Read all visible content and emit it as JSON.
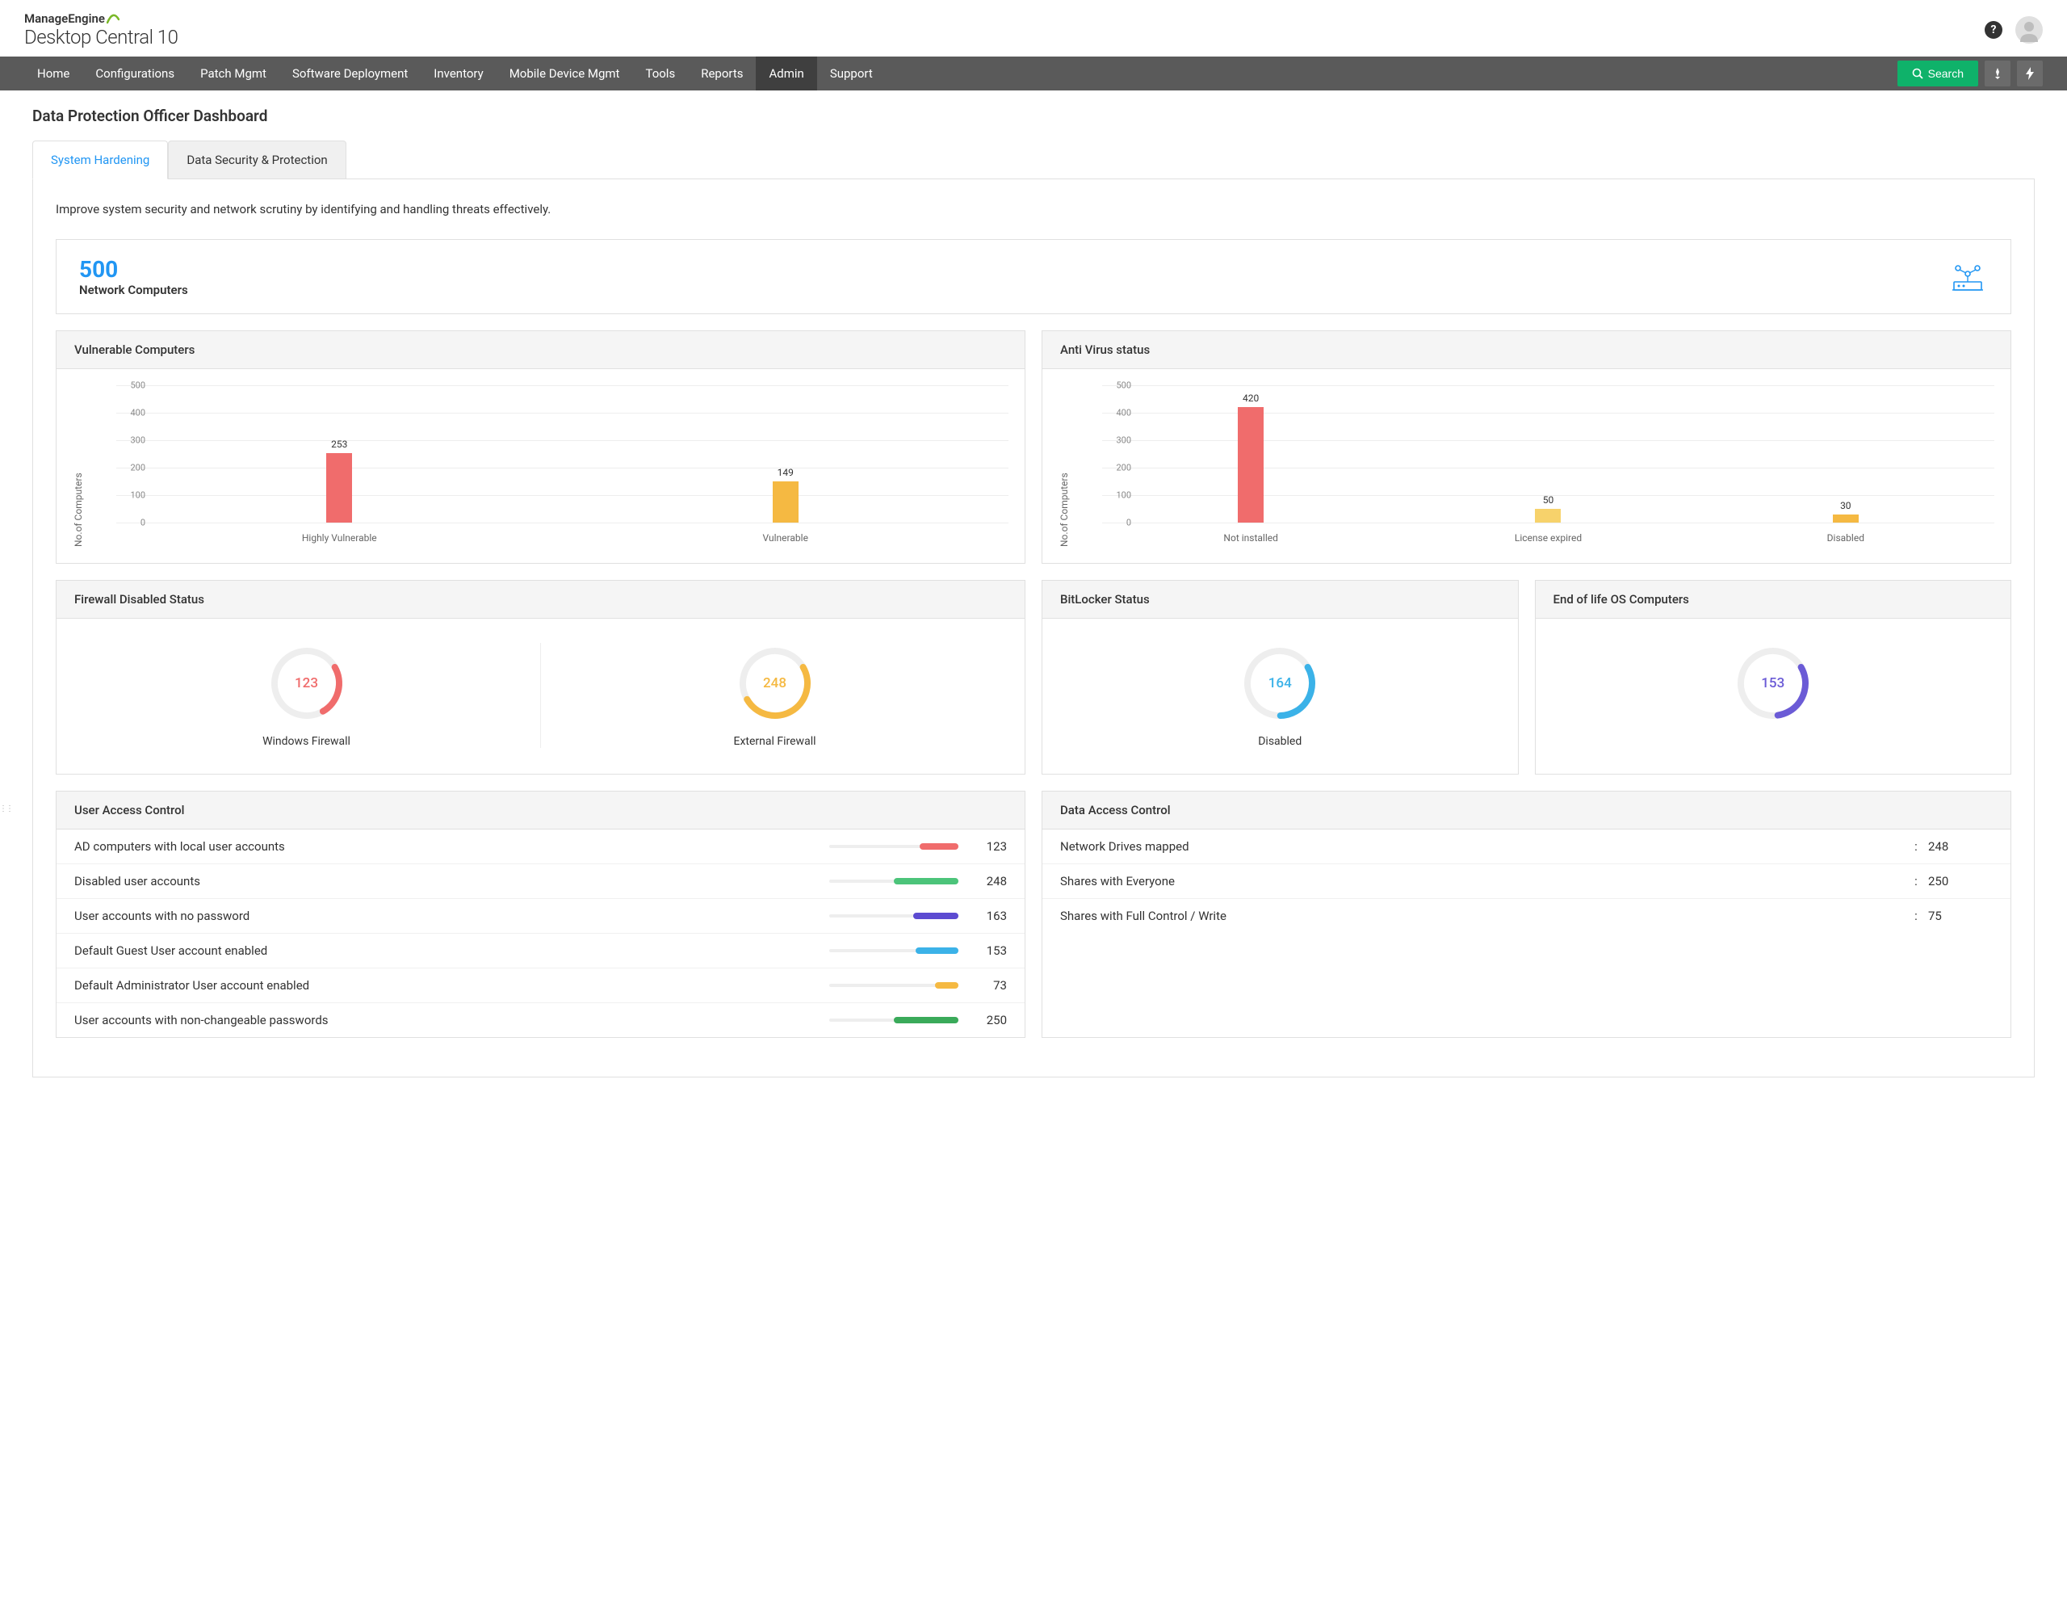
{
  "brand": {
    "top": "ManageEngine",
    "bottom": "Desktop Central 10"
  },
  "nav": {
    "items": [
      "Home",
      "Configurations",
      "Patch Mgmt",
      "Software Deployment",
      "Inventory",
      "Mobile Device Mgmt",
      "Tools",
      "Reports",
      "Admin",
      "Support"
    ],
    "active_index": 8,
    "search_label": "Search"
  },
  "page_title": "Data Protection Officer Dashboard",
  "tabs": {
    "items": [
      "System Hardening",
      "Data Security & Protection"
    ],
    "active_index": 0
  },
  "intro": "Improve system security and network scrutiny by identifying and handling threats effectively.",
  "summary": {
    "value": "500",
    "label": "Network Computers"
  },
  "chart_data": [
    {
      "id": "vulnerable",
      "type": "bar",
      "title": "Vulnerable Computers",
      "ylabel": "No.of Computers",
      "ylim": [
        0,
        500
      ],
      "yticks": [
        0,
        100,
        200,
        300,
        400,
        500
      ],
      "categories": [
        "Highly Vulnerable",
        "Vulnerable"
      ],
      "values": [
        253,
        149
      ],
      "colors": [
        "#f06c6c",
        "#f5b942"
      ]
    },
    {
      "id": "antivirus",
      "type": "bar",
      "title": "Anti Virus status",
      "ylabel": "No.of Computers",
      "ylim": [
        0,
        500
      ],
      "yticks": [
        0,
        100,
        200,
        300,
        400,
        500
      ],
      "categories": [
        "Not installed",
        "License expired",
        "Disabled"
      ],
      "values": [
        420,
        50,
        30
      ],
      "colors": [
        "#f06c6c",
        "#f7d26b",
        "#f5b942"
      ]
    },
    {
      "id": "firewall",
      "type": "donut",
      "title": "Firewall Disabled Status",
      "series": [
        {
          "name": "Windows Firewall",
          "value": 123,
          "color": "#f06c6c",
          "frac": 0.25
        },
        {
          "name": "External Firewall",
          "value": 248,
          "color": "#f5b942",
          "frac": 0.5
        }
      ]
    },
    {
      "id": "bitlocker",
      "type": "donut",
      "title": "BitLocker Status",
      "series": [
        {
          "name": "Disabled",
          "value": 164,
          "color": "#3bb2e8",
          "frac": 0.33
        }
      ]
    },
    {
      "id": "eol",
      "type": "donut",
      "title": "End of life OS Computers",
      "series": [
        {
          "name": "",
          "value": 153,
          "color": "#6b5bd6",
          "frac": 0.31
        }
      ]
    }
  ],
  "user_access": {
    "title": "User Access Control",
    "rows": [
      {
        "label": "AD computers with local  user accounts",
        "value": 123,
        "color": "#f06c6c",
        "frac": 0.3
      },
      {
        "label": "Disabled user accounts",
        "value": 248,
        "color": "#4cc47a",
        "frac": 0.5
      },
      {
        "label": "User accounts with no password",
        "value": 163,
        "color": "#5c4bd1",
        "frac": 0.35
      },
      {
        "label": "Default Guest User account  enabled",
        "value": 153,
        "color": "#3bb2e8",
        "frac": 0.33
      },
      {
        "label": "Default Administrator User account enabled",
        "value": 73,
        "color": "#f5b942",
        "frac": 0.18
      },
      {
        "label": "User accounts with non-changeable passwords",
        "value": 250,
        "color": "#3aaa5a",
        "frac": 0.5
      }
    ]
  },
  "data_access": {
    "title": "Data Access Control",
    "rows": [
      {
        "label": "Network Drives mapped",
        "value": 248
      },
      {
        "label": "Shares with Everyone",
        "value": 250
      },
      {
        "label": "Shares with Full Control / Write",
        "value": 75
      }
    ]
  }
}
